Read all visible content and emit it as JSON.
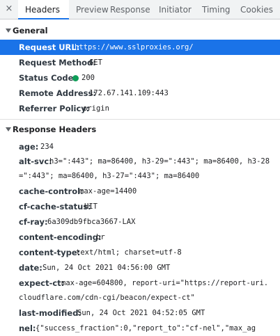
{
  "tabs": {
    "close_icon": "×",
    "items": [
      "Headers",
      "Preview",
      "Response",
      "Initiator",
      "Timing",
      "Cookies"
    ],
    "active": "Headers",
    "accent": "#1a73e8"
  },
  "general": {
    "title": "General",
    "rows": [
      {
        "key": "Request URL:",
        "value": "https://www.sslproxies.org/"
      },
      {
        "key": "Request Method:",
        "value": "GET"
      },
      {
        "key": "Status Code:",
        "value": "200",
        "status_color": "#0f9d58"
      },
      {
        "key": "Remote Address:",
        "value": "172.67.141.109:443"
      },
      {
        "key": "Referrer Policy:",
        "value": "origin"
      }
    ]
  },
  "response_headers": {
    "title": "Response Headers",
    "rows": [
      {
        "key": "age:",
        "value": "234"
      },
      {
        "key": "alt-svc:",
        "value": "h3=\":443\"; ma=86400, h3-29=\":443\"; ma=86400, h3-28",
        "cont": "=\":443\"; ma=86400, h3-27=\":443\"; ma=86400"
      },
      {
        "key": "cache-control:",
        "value": "max-age=14400"
      },
      {
        "key": "cf-cache-status:",
        "value": "HIT"
      },
      {
        "key": "cf-ray:",
        "value": "6a309db9fbca3667-LAX"
      },
      {
        "key": "content-encoding:",
        "value": "br"
      },
      {
        "key": "content-type:",
        "value": "text/html; charset=utf-8"
      },
      {
        "key": "date:",
        "value": "Sun, 24 Oct 2021 04:56:00 GMT"
      },
      {
        "key": "expect-ct:",
        "value": "max-age=604800, report-uri=\"https://report-uri.",
        "cont": "cloudflare.com/cdn-cgi/beacon/expect-ct\""
      },
      {
        "key": "last-modified:",
        "value": "Sun, 24 Oct 2021 04:52:05 GMT"
      },
      {
        "key": "nel:",
        "value": "{\"success_fraction\":0,\"report_to\":\"cf-nel\",\"max_ag"
      }
    ]
  }
}
